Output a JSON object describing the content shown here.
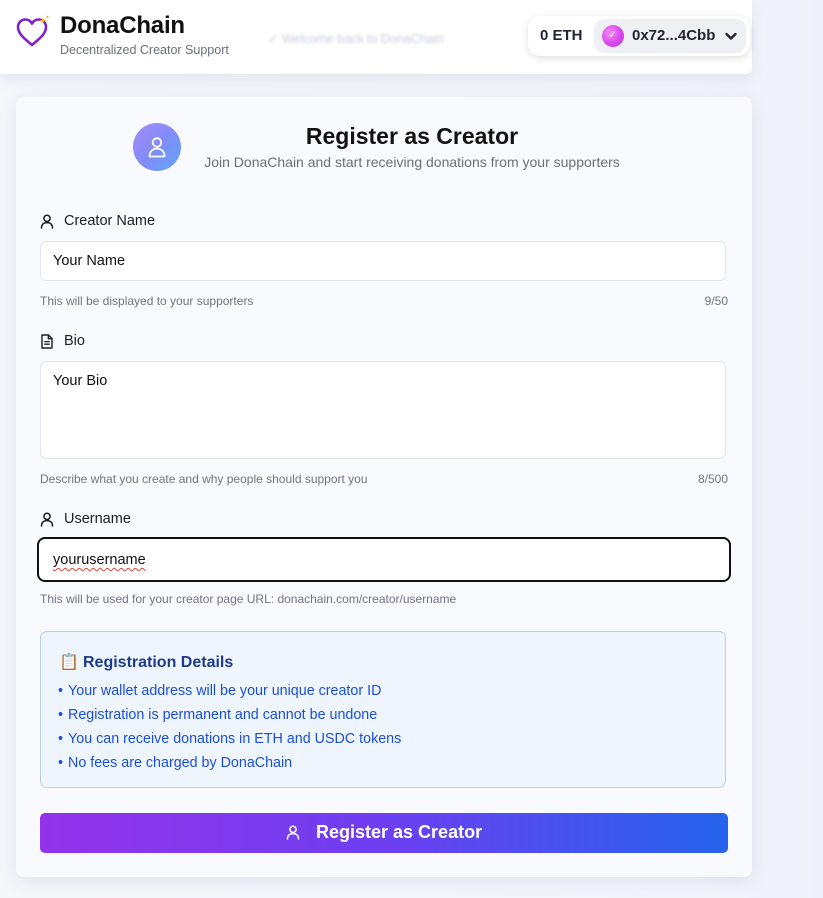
{
  "header": {
    "app_name": "DonaChain",
    "tagline": "Decentralized Creator Support",
    "faded_message": "✓ Welcome back to DonaChain",
    "balance": "0 ETH",
    "account_address": "0x72...4Cbb"
  },
  "card": {
    "title": "Register as Creator",
    "subtitle": "Join DonaChain and start receiving donations from your supporters"
  },
  "form": {
    "creator_name": {
      "label": "Creator Name",
      "value": "Your Name",
      "hint": "This will be displayed to your supporters",
      "counter": "9/50"
    },
    "bio": {
      "label": "Bio",
      "value": "Your Bio",
      "hint": "Describe what you create and why people should support you",
      "counter": "8/500"
    },
    "username": {
      "label": "Username",
      "value": "yourusername",
      "hint": "This will be used for your creator page URL: donachain.com/creator/username"
    }
  },
  "info": {
    "icon": "📋",
    "title": "Registration Details",
    "items": [
      "Your wallet address will be your unique creator ID",
      "Registration is permanent and cannot be undone",
      "You can receive donations in ETH and USDC tokens",
      "No fees are charged by DonaChain"
    ]
  },
  "submit": {
    "label": "Register as Creator"
  },
  "colors": {
    "brand_purple": "#9333ea",
    "brand_blue": "#2563eb",
    "info_text": "#1d4ed8",
    "info_title": "#1e3a8a"
  },
  "icons": {
    "logo": "heart-sparkle-icon",
    "user": "user-icon",
    "document": "document-icon",
    "chevron": "chevron-down-icon"
  }
}
